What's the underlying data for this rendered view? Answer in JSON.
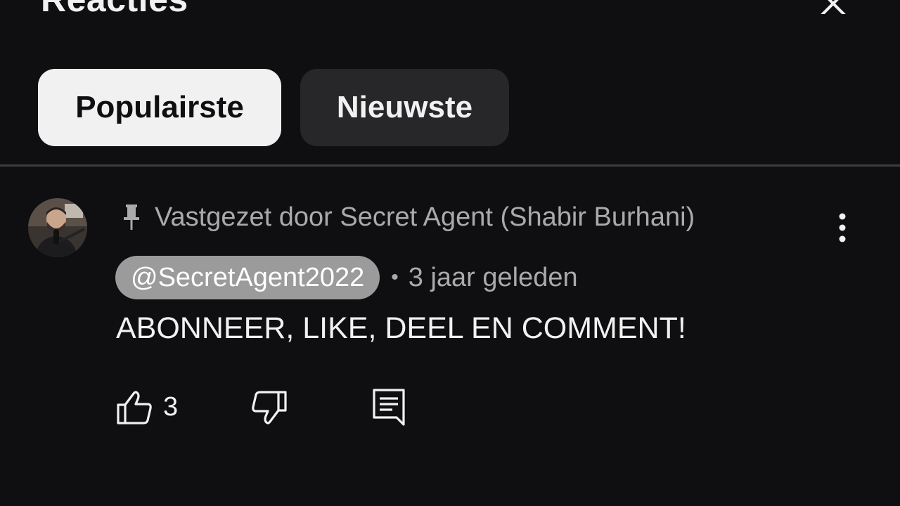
{
  "header": {
    "title": "Reacties",
    "close_icon": "close-icon"
  },
  "sort_chips": [
    {
      "label": "Populairste",
      "active": true
    },
    {
      "label": "Nieuwste",
      "active": false
    }
  ],
  "comment": {
    "avatar_icon": "avatar",
    "pinned_icon": "pin-icon",
    "pinned_text": "Vastgezet door Secret Agent (Shabir Burhani)",
    "author_handle": "@SecretAgent2022",
    "separator": "•",
    "timestamp": "3 jaar geleden",
    "text": "ABONNEER, LIKE, DEEL EN COMMENT!",
    "like_count": "3",
    "actions": [
      "thumbs-up-icon",
      "thumbs-down-icon",
      "reply-icon",
      "more-vertical-icon"
    ]
  },
  "colors": {
    "background": "#0f0e11",
    "chip_active_bg": "#f1f1f1",
    "chip_inactive_bg": "#272628",
    "secondary_text": "#aaaaaa",
    "handle_pill_bg": "#9b9b9b"
  }
}
